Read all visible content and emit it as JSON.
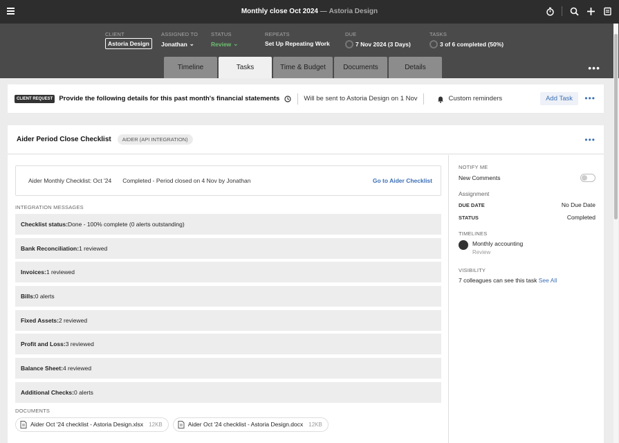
{
  "title": {
    "main": "Monthly close Oct 2024",
    "sep": "—",
    "client": "Astoria Design"
  },
  "meta": {
    "client": {
      "label": "CLIENT",
      "value": "Astoria Design"
    },
    "assigned": {
      "label": "ASSIGNED TO",
      "value": "Jonathan"
    },
    "status": {
      "label": "STATUS",
      "value": "Review"
    },
    "repeats": {
      "label": "REPEATS",
      "value": "Set Up Repeating Work"
    },
    "due": {
      "label": "DUE",
      "value": "7 Nov 2024 (3 Days)"
    },
    "tasks": {
      "label": "TASKS",
      "value": "3 of 6 completed (50%)"
    }
  },
  "tabs": [
    "Timeline",
    "Tasks",
    "Time & Budget",
    "Documents",
    "Details"
  ],
  "active_tab": "Tasks",
  "request": {
    "badge": "CLIENT REQUEST",
    "text": "Provide the following details for this past month's financial statements",
    "send": "Will be sent to Astoria Design on 1 Nov",
    "reminders": "Custom reminders",
    "add_task": "Add Task"
  },
  "checklist": {
    "title": "Aider Period Close Checklist",
    "tag": "AIDER (API INTEGRATION)",
    "summary_name": "Aider Monthly Checklist: Oct '24",
    "summary_status": "Completed - Period closed on 4 Nov by Jonathan",
    "summary_link": "Go to Aider Checklist",
    "messages_label": "INTEGRATION MESSAGES",
    "messages": [
      {
        "key": "Checklist status:",
        "val": " Done - 100% complete (0 alerts outstanding)"
      },
      {
        "key": "Bank Reconciliation:",
        "val": " 1 reviewed"
      },
      {
        "key": "Invoices:",
        "val": " 1 reviewed"
      },
      {
        "key": "Bills:",
        "val": " 0 alerts"
      },
      {
        "key": "Fixed Assets:",
        "val": " 2 reviewed"
      },
      {
        "key": "Profit and Loss:",
        "val": " 3 reviewed"
      },
      {
        "key": "Balance Sheet:",
        "val": " 4 reviewed"
      },
      {
        "key": "Additional Checks:",
        "val": " 0 alerts"
      }
    ],
    "documents_label": "DOCUMENTS",
    "documents": [
      {
        "name": "Aider Oct '24 checklist - Astoria Design.xlsx",
        "size": "12KB"
      },
      {
        "name": "Aider Oct '24 checklist - Astoria Design.docx",
        "size": "12KB"
      }
    ]
  },
  "side": {
    "notify_label": "NOTIFY ME",
    "new_comments": "New Comments",
    "assignment": "Assignment",
    "due_key": "DUE DATE",
    "due_val": "No Due Date",
    "status_key": "STATUS",
    "status_val": "Completed",
    "timelines_label": "TIMELINES",
    "timeline_name": "Monthly accounting",
    "timeline_sub": "Review",
    "visibility_label": "VISIBILITY",
    "visibility_text": "7 colleagues can see this task ",
    "visibility_link": "See All"
  },
  "colors": {
    "topbar": "#2d2d2d",
    "header": "#4a4a4a",
    "status": "#6cc070",
    "link": "#3b6fb6"
  }
}
